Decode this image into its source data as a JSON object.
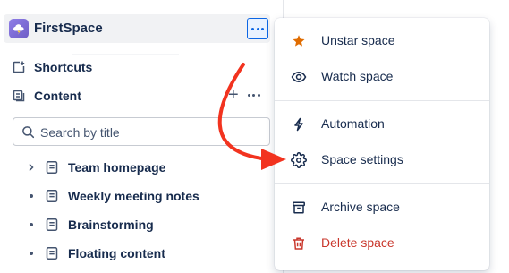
{
  "space": {
    "name": "FirstSpace",
    "avatar_icon": "cloud-lightning-icon",
    "more_icon": "more-horizontal-icon"
  },
  "sidebar": {
    "shortcuts": {
      "label": "Shortcuts",
      "icon": "shortcut-icon"
    },
    "content": {
      "label": "Content",
      "icon": "content-icon",
      "add_icon": "plus-icon",
      "more_icon": "more-horizontal-icon"
    },
    "search": {
      "placeholder": "Search by title",
      "value": "",
      "icon": "search-icon"
    },
    "tree": [
      {
        "label": "Team homepage",
        "lead": "chevron-right-icon",
        "icon": "page-icon"
      },
      {
        "label": "Weekly meeting notes",
        "lead": "bullet",
        "icon": "page-icon"
      },
      {
        "label": "Brainstorming",
        "lead": "bullet",
        "icon": "page-icon"
      },
      {
        "label": "Floating content",
        "lead": "bullet",
        "icon": "page-icon"
      }
    ]
  },
  "menu": {
    "items": [
      {
        "label": "Unstar space",
        "icon": "star-icon"
      },
      {
        "label": "Watch space",
        "icon": "eye-icon"
      },
      {
        "label": "Automation",
        "icon": "lightning-icon"
      },
      {
        "label": "Space settings",
        "icon": "gear-icon"
      },
      {
        "label": "Archive space",
        "icon": "archive-icon"
      },
      {
        "label": "Delete space",
        "icon": "trash-icon"
      }
    ]
  },
  "colors": {
    "accent": "#0c66e4",
    "star": "#e06c00",
    "danger": "#c9372c",
    "annotation_arrow": "#f2331f",
    "avatar": "#7b6ad6"
  }
}
